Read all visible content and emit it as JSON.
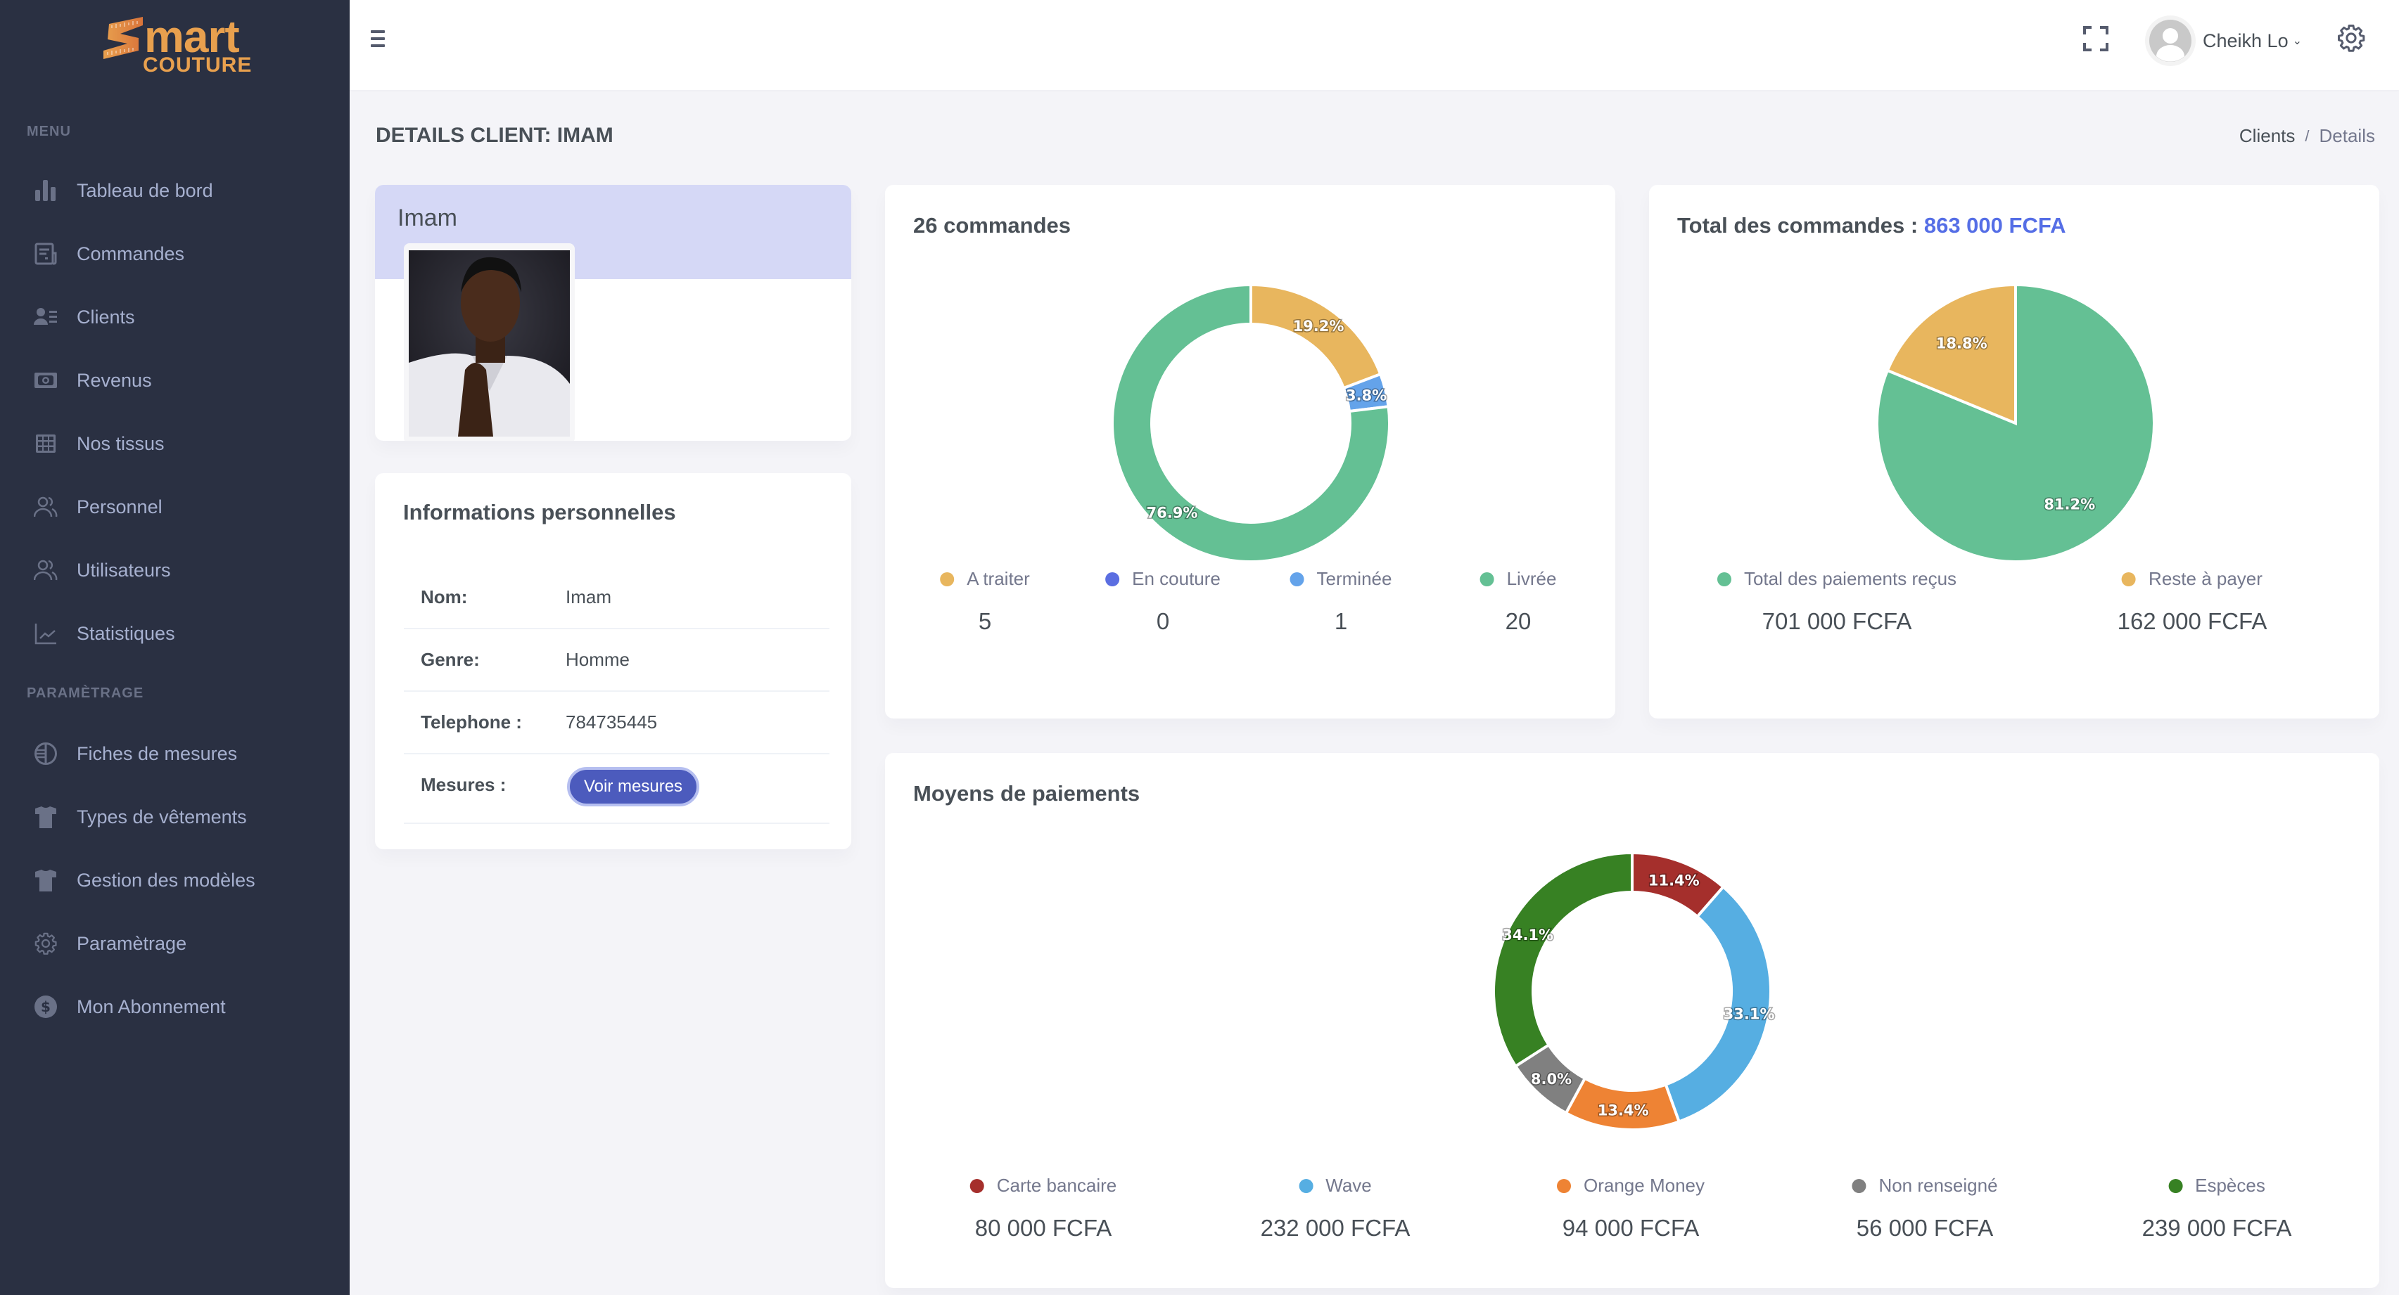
{
  "app": {
    "logo_text_top": "mart",
    "logo_text_bottom": "COUTURE",
    "brand_color": "#e8a04e"
  },
  "sidebar": {
    "sections": [
      {
        "title": "MENU",
        "items": [
          {
            "label": "Tableau de bord",
            "icon": "bar-chart-icon"
          },
          {
            "label": "Commandes",
            "icon": "receipt-icon"
          },
          {
            "label": "Clients",
            "icon": "user-list-icon"
          },
          {
            "label": "Revenus",
            "icon": "money-icon"
          },
          {
            "label": "Nos tissus",
            "icon": "grid-icon"
          },
          {
            "label": "Personnel",
            "icon": "users-icon"
          },
          {
            "label": "Utilisateurs",
            "icon": "users-icon"
          },
          {
            "label": "Statistiques",
            "icon": "line-chart-icon"
          }
        ]
      },
      {
        "title": "PARAMÈTRAGE",
        "items": [
          {
            "label": "Fiches de mesures",
            "icon": "measure-circle-icon"
          },
          {
            "label": "Types de vêtements",
            "icon": "tshirt-icon"
          },
          {
            "label": "Gestion des modèles",
            "icon": "tshirt-icon"
          },
          {
            "label": "Paramètrage",
            "icon": "gear-icon"
          },
          {
            "label": "Mon Abonnement",
            "icon": "dollar-circle-icon"
          }
        ]
      }
    ]
  },
  "header": {
    "user_name": "Cheikh Lo"
  },
  "page": {
    "title": "DETAILS CLIENT: IMAM",
    "breadcrumb": [
      "Clients",
      "Details"
    ]
  },
  "profile": {
    "name": "Imam"
  },
  "info": {
    "title": "Informations personnelles",
    "rows": [
      {
        "label": "Nom:",
        "value": "Imam"
      },
      {
        "label": "Genre:",
        "value": "Homme"
      },
      {
        "label": "Telephone :",
        "value": "784735445"
      },
      {
        "label": "Mesures :",
        "button": "Voir mesures"
      }
    ]
  },
  "orders_card": {
    "title": "26 commandes"
  },
  "total_card": {
    "title_prefix": "Total des commandes : ",
    "title_value": "863 000 FCFA"
  },
  "payments_card": {
    "title": "Moyens de paiements"
  },
  "chart_data": [
    {
      "type": "pie",
      "variant": "donut",
      "title": "26 commandes",
      "categories": [
        "A traiter",
        "En couture",
        "Terminée",
        "Livrée"
      ],
      "values": [
        5,
        0,
        1,
        20
      ],
      "display_values": [
        "5",
        "0",
        "1",
        "20"
      ],
      "labels": [
        "19.2%",
        "",
        "3.8%",
        "76.9%"
      ],
      "colors": [
        "#e8b65e",
        "#5b6ee1",
        "#64a3ea",
        "#64c094"
      ],
      "legend": "bottom"
    },
    {
      "type": "pie",
      "variant": "pie",
      "title": "Total des commandes : 863 000 FCFA",
      "categories": [
        "Total des paiements reçus",
        "Reste à payer"
      ],
      "values": [
        701000,
        162000
      ],
      "display_values": [
        "701 000 FCFA",
        "162 000 FCFA"
      ],
      "labels": [
        "81.2%",
        "18.8%"
      ],
      "colors": [
        "#64c094",
        "#e8b65e"
      ],
      "legend": "bottom"
    },
    {
      "type": "pie",
      "variant": "donut",
      "title": "Moyens de paiements",
      "categories": [
        "Carte bancaire",
        "Wave",
        "Orange Money",
        "Non renseigné",
        "Espèces"
      ],
      "values": [
        80000,
        232000,
        94000,
        56000,
        239000
      ],
      "display_values": [
        "80 000 FCFA",
        "232 000 FCFA",
        "94 000 FCFA",
        "56 000 FCFA",
        "239 000 FCFA"
      ],
      "labels": [
        "11.4%",
        "33.1%",
        "13.4%",
        "8.0%",
        "34.1%"
      ],
      "colors": [
        "#a52f2c",
        "#56aee2",
        "#ee8334",
        "#808080",
        "#378123"
      ],
      "legend": "bottom"
    }
  ]
}
